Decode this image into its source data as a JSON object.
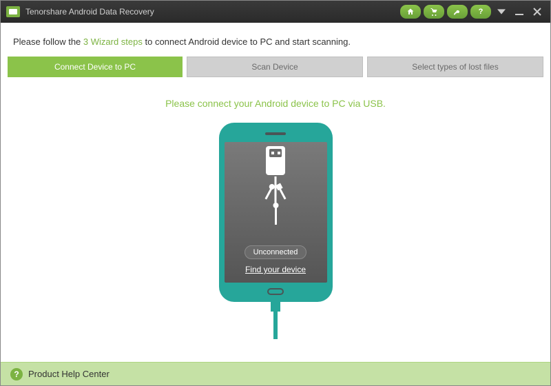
{
  "titlebar": {
    "title": "Tenorshare Android Data Recovery"
  },
  "instruction": {
    "prefix": "Please follow the ",
    "highlight": "3 Wizard steps",
    "suffix": " to connect Android device to PC and start scanning."
  },
  "tabs": [
    {
      "label": "Connect Device to PC",
      "active": true
    },
    {
      "label": "Scan Device",
      "active": false
    },
    {
      "label": "Select types of lost files",
      "active": false
    }
  ],
  "main": {
    "message": "Please connect your Android device to PC via USB.",
    "status": "Unconnected",
    "find_link": "Find your device"
  },
  "footer": {
    "help_label": "Product Help Center"
  },
  "icons": {
    "home": "home-icon",
    "cart": "cart-icon",
    "key": "key-icon",
    "help": "help-icon",
    "dropdown": "dropdown-icon",
    "minimize": "minimize-icon",
    "close": "close-icon"
  }
}
